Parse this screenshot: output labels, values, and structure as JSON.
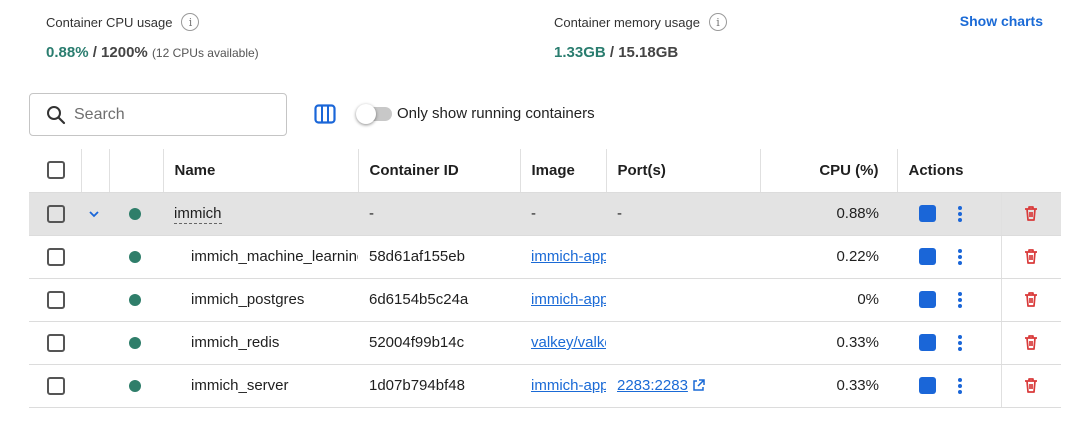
{
  "stats": {
    "cpu_label": "Container CPU usage",
    "cpu_value": "0.88%",
    "cpu_total": "/ 1200%",
    "cpu_note": "(12 CPUs available)",
    "mem_label": "Container memory usage",
    "mem_value": "1.33GB",
    "mem_total": "/ 15.18GB",
    "show_charts": "Show charts"
  },
  "toolbar": {
    "search_placeholder": "Search",
    "toggle_label": "Only show running containers",
    "toggle_on": false
  },
  "table": {
    "headers": {
      "name": "Name",
      "container_id": "Container ID",
      "image": "Image",
      "ports": "Port(s)",
      "cpu": "CPU (%)",
      "actions": "Actions"
    },
    "group": {
      "name": "immich",
      "container_id": "-",
      "image": "-",
      "ports": "-",
      "cpu": "0.88%"
    },
    "rows": [
      {
        "name": "immich_machine_learning",
        "container_id": "58d61af155eb",
        "image": "immich-app",
        "ports": "",
        "cpu": "0.22%"
      },
      {
        "name": "immich_postgres",
        "container_id": "6d6154b5c24a",
        "image": "immich-app",
        "ports": "",
        "cpu": "0%"
      },
      {
        "name": "immich_redis",
        "container_id": "52004f99b14c",
        "image": "valkey/valkey",
        "ports": "",
        "cpu": "0.33%"
      },
      {
        "name": "immich_server",
        "container_id": "1d07b794bf48",
        "image": "immich-app",
        "ports": "2283:2283",
        "cpu": "0.33%"
      }
    ]
  },
  "colors": {
    "accent": "#1a66d8",
    "running": "#2f7e6a",
    "delete": "#d93a3a",
    "group_row": "#e3e3e3"
  },
  "icons": {
    "info": "info-icon",
    "search": "search-icon",
    "columns": "columns-icon",
    "chevron": "chevron-down-icon",
    "stop": "stop-icon",
    "more": "more-vertical-icon",
    "delete": "trash-icon",
    "external": "external-link-icon"
  }
}
